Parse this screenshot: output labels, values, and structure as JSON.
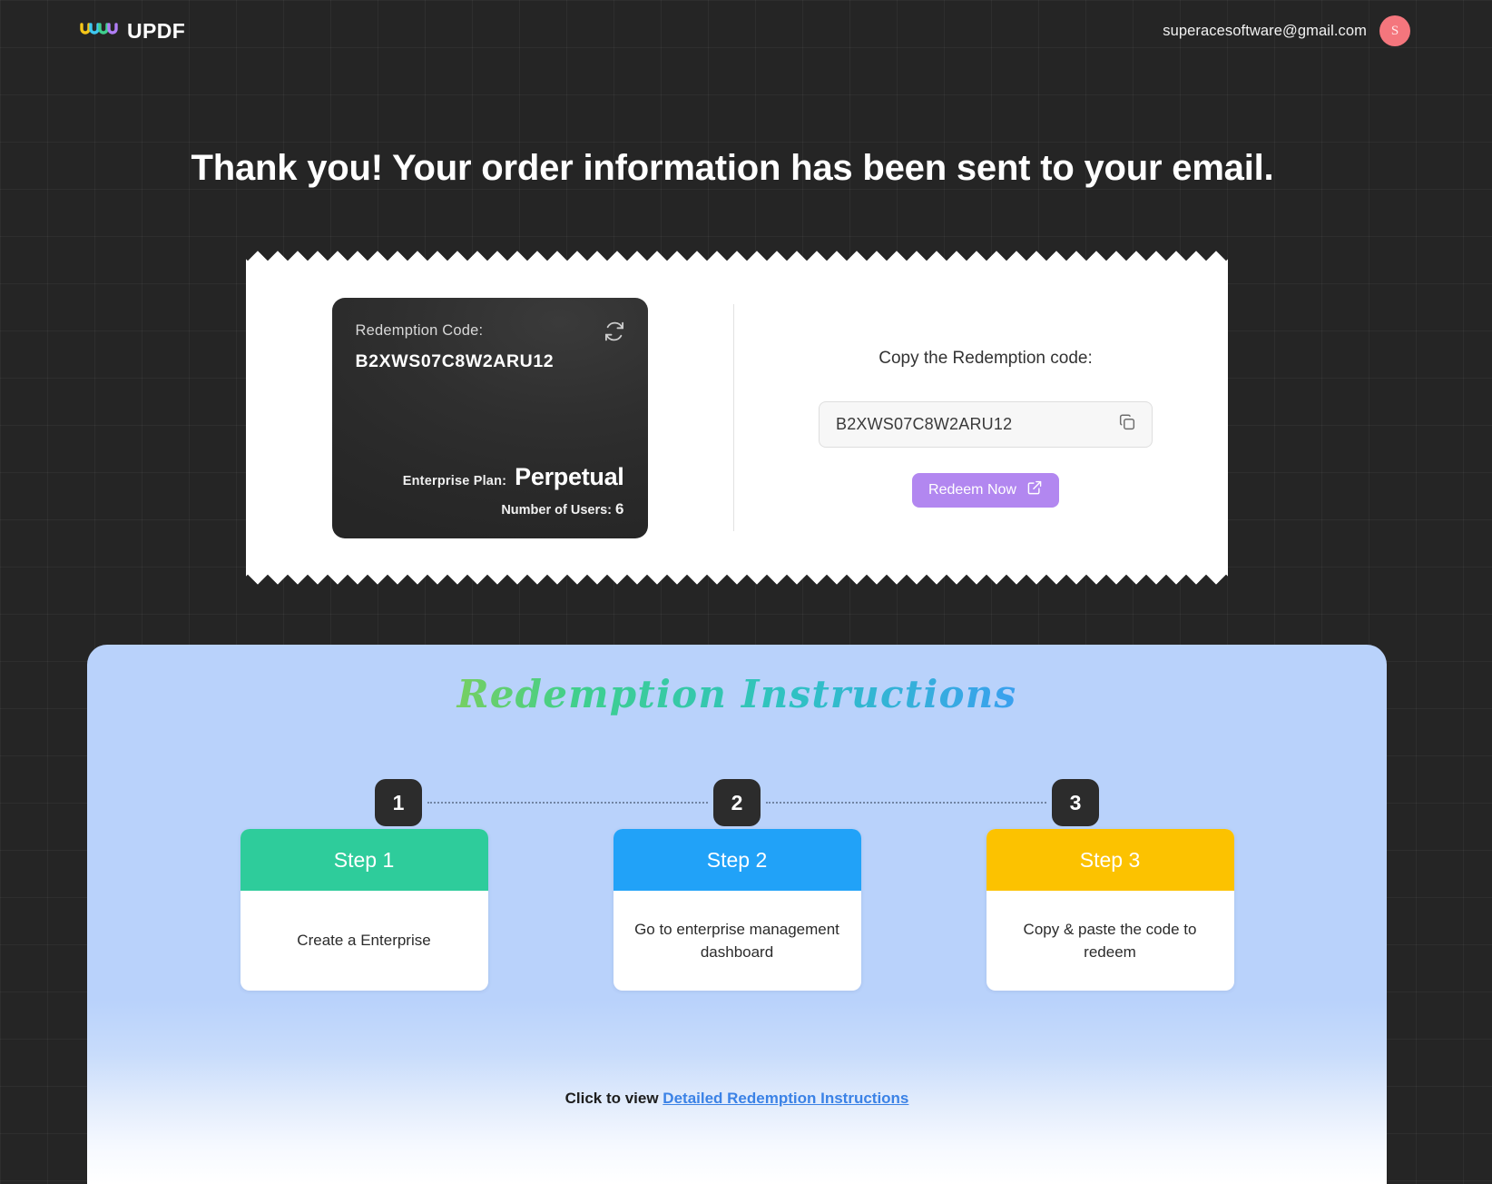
{
  "topbar": {
    "brand_name": "UPDF",
    "brand_mark_icon": "updf-wave-logo-icon",
    "brand_wave_colors": [
      "#f5c518",
      "#3ec8f0",
      "#3ecf8e",
      "#b07ef5"
    ],
    "account_email": "superacesoftware@gmail.com",
    "avatar_initial": "S",
    "avatar_color": "#f4767d"
  },
  "headline": "Thank you! Your order information has been sent to your email.",
  "ticket": {
    "code_card": {
      "label": "Redemption Code:",
      "code": "B2XWS07C8W2ARU12",
      "refresh_icon": "refresh-icon",
      "plan_label": "Enterprise Plan:",
      "plan_value": "Perpetual",
      "users_label": "Number of Users:",
      "users_count": "6"
    },
    "copy_panel": {
      "title": "Copy the Redemption code:",
      "field_value": "B2XWS07C8W2ARU12",
      "copy_icon": "copy-icon",
      "redeem_label": "Redeem Now",
      "redeem_icon": "external-link-icon",
      "redeem_color": "#b287f0"
    },
    "annotation_icon": "blue-arrow-annotation-icon",
    "annotation_color": "#2c3fd4"
  },
  "instructions": {
    "title": "Redemption Instructions",
    "badges": [
      "1",
      "2",
      "3"
    ],
    "steps": [
      {
        "head": "Step 1",
        "body": "Create a Enterprise",
        "color": "#2ecc9b"
      },
      {
        "head": "Step 2",
        "body": "Go to enterprise management dashboard",
        "color": "#21a2f8"
      },
      {
        "head": "Step 3",
        "body": "Copy & paste the code to redeem",
        "color": "#fcc200"
      }
    ],
    "footer_prefix": "Click to view ",
    "footer_link": "Detailed Redemption Instructions"
  }
}
